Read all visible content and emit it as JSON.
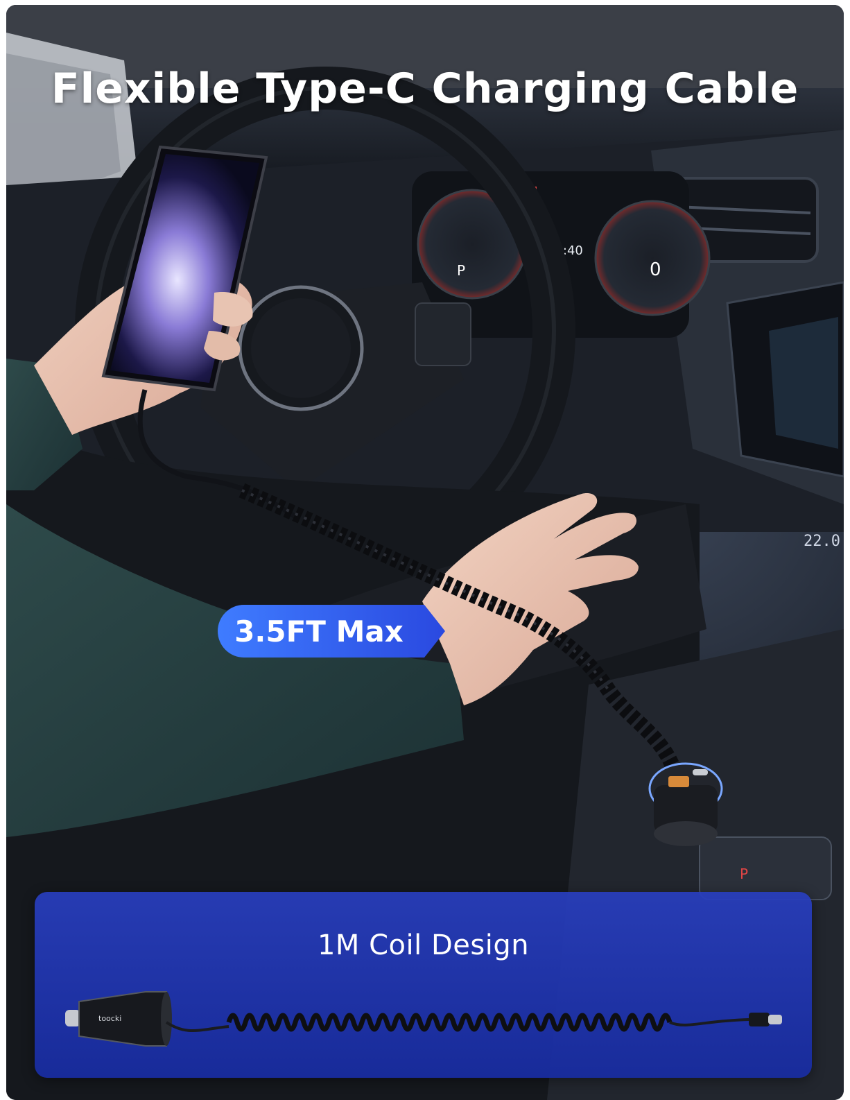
{
  "headline": "Flexible Type-C Charging Cable",
  "badge": {
    "text": "3.5FT Max"
  },
  "panel": {
    "title": "1M Coil Design"
  },
  "colors": {
    "badge_gradient_start": "#3f7cff",
    "badge_gradient_end": "#2a49e0",
    "panel_blue": "#2238b0",
    "text": "#ffffff"
  },
  "icons": [
    "car-charger-icon",
    "coiled-cable-icon",
    "usb-c-connector-icon"
  ]
}
